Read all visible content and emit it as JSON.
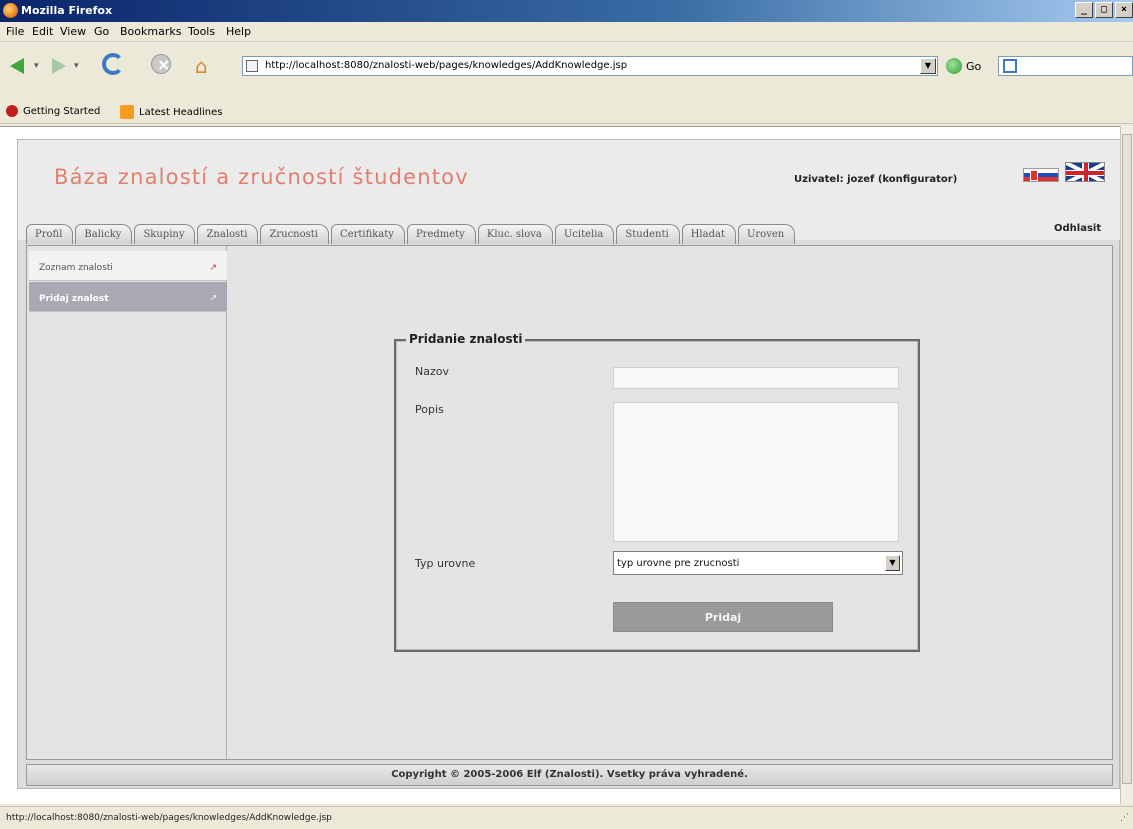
{
  "window": {
    "title": "Mozilla Firefox",
    "controls": [
      "_",
      "□",
      "×"
    ]
  },
  "menu": [
    "File",
    "Edit",
    "View",
    "Go",
    "Bookmarks",
    "Tools",
    "Help"
  ],
  "toolbar": {
    "url": "http://localhost:8080/znalosti-web/pages/knowledges/AddKnowledge.jsp",
    "go_label": "Go",
    "search_placeholder": ""
  },
  "bookmarks": [
    {
      "label": "Getting Started",
      "icon": "red-bookmark-icon"
    },
    {
      "label": "Latest Headlines",
      "icon": "rss-icon"
    }
  ],
  "header": {
    "site_title": "Báza znalostí a zručností študentov",
    "user_label": "Uzivatel: jozef (konfigurator)",
    "logout": "Odhlasit"
  },
  "tabs": [
    "Profil",
    "Balicky",
    "Skupiny",
    "Znalosti",
    "Zrucnosti",
    "Certifikaty",
    "Predmety",
    "Kluc. slova",
    "Ucitelia",
    "Studenti",
    "Hladat",
    "Uroven"
  ],
  "sidebar": {
    "items": [
      {
        "label": "Zoznam znalosti",
        "active": false
      },
      {
        "label": "Pridaj znalost",
        "active": true
      }
    ]
  },
  "form": {
    "legend": "Pridanie znalosti",
    "name_label": "Nazov",
    "name_value": "",
    "desc_label": "Popis",
    "desc_value": "",
    "type_label": "Typ urovne",
    "type_value": "typ urovne pre zrucnosti",
    "submit_label": "Pridaj"
  },
  "footer": {
    "copyright": "Copyright © 2005-2006 Elf (Znalosti). Vsetky práva vyhradené."
  },
  "status": {
    "text": "http://localhost:8080/znalosti-web/pages/knowledges/AddKnowledge.jsp"
  },
  "colors": {
    "title_accent": "#e17e6d",
    "active_sidebar": "#a9a9b4",
    "button": "#9a9a9a"
  }
}
